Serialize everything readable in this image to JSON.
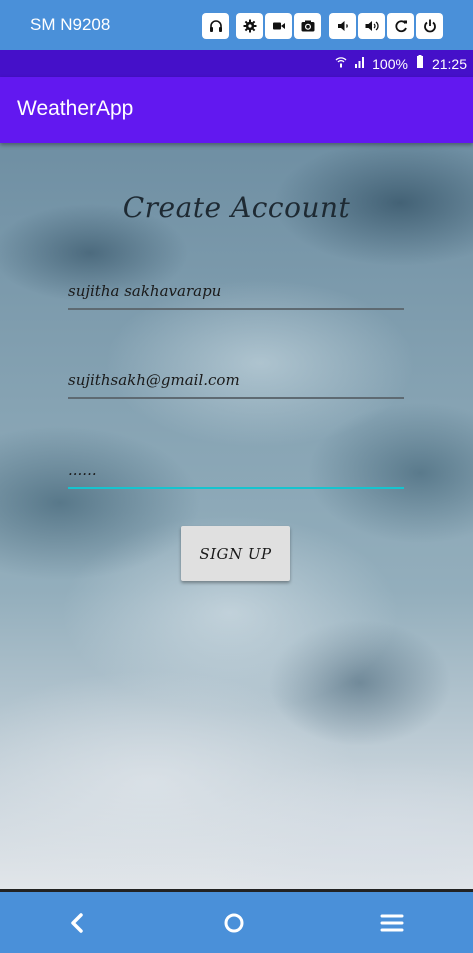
{
  "emulator": {
    "device_name": "SM N9208",
    "buttons": [
      "headphones-icon",
      "gear-icon",
      "video-camera-icon",
      "camera-icon",
      "volume-down-icon",
      "volume-up-icon",
      "rotate-icon",
      "power-icon"
    ]
  },
  "status_bar": {
    "battery": "100%",
    "time": "21:25"
  },
  "app_bar": {
    "title": "WeatherApp"
  },
  "form": {
    "heading": "Create Account",
    "name_value": "sujitha sakhavarapu",
    "email_value": "sujithsakh@gmail.com",
    "password_value": "......",
    "signup_label": "SIGN UP"
  },
  "colors": {
    "status_bar": "#4510c9",
    "app_bar": "#6218f0",
    "emulator_bar": "#4a90d9",
    "active_underline": "#16c4cf"
  },
  "nav": [
    "back-icon",
    "home-icon",
    "recents-menu-icon"
  ]
}
